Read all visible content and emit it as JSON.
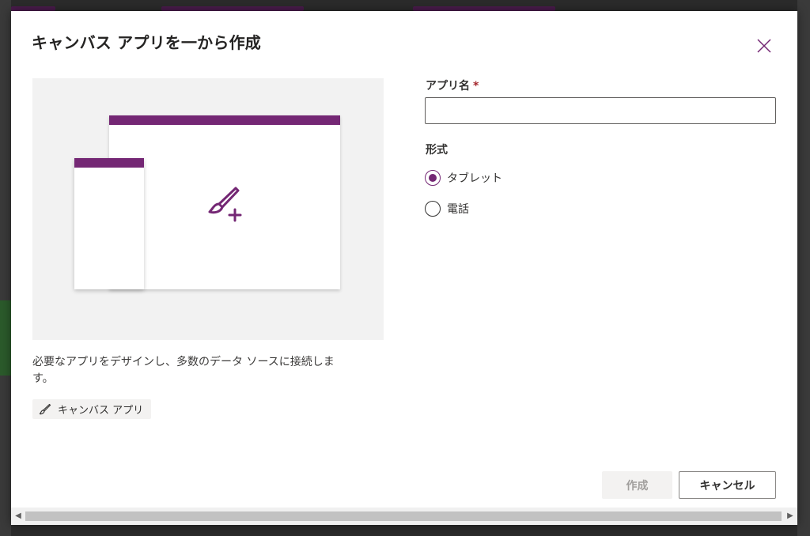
{
  "dialog": {
    "title": "キャンバス アプリを一から作成",
    "close_icon": "close-icon"
  },
  "illustration": {
    "accent_color": "#742774",
    "icon": "paintbrush-plus-icon"
  },
  "description": "必要なアプリをデザインし、多数のデータ ソースに接続します。",
  "tag": {
    "icon": "paintbrush-icon",
    "label": "キャンバス アプリ"
  },
  "form": {
    "app_name": {
      "label": "アプリ名",
      "required_mark": "*",
      "value": "",
      "placeholder": ""
    },
    "format": {
      "label": "形式",
      "options": [
        {
          "label": "タブレット",
          "selected": true
        },
        {
          "label": "電話",
          "selected": false
        }
      ]
    }
  },
  "buttons": {
    "create": "作成",
    "create_enabled": false,
    "cancel": "キャンセル"
  }
}
